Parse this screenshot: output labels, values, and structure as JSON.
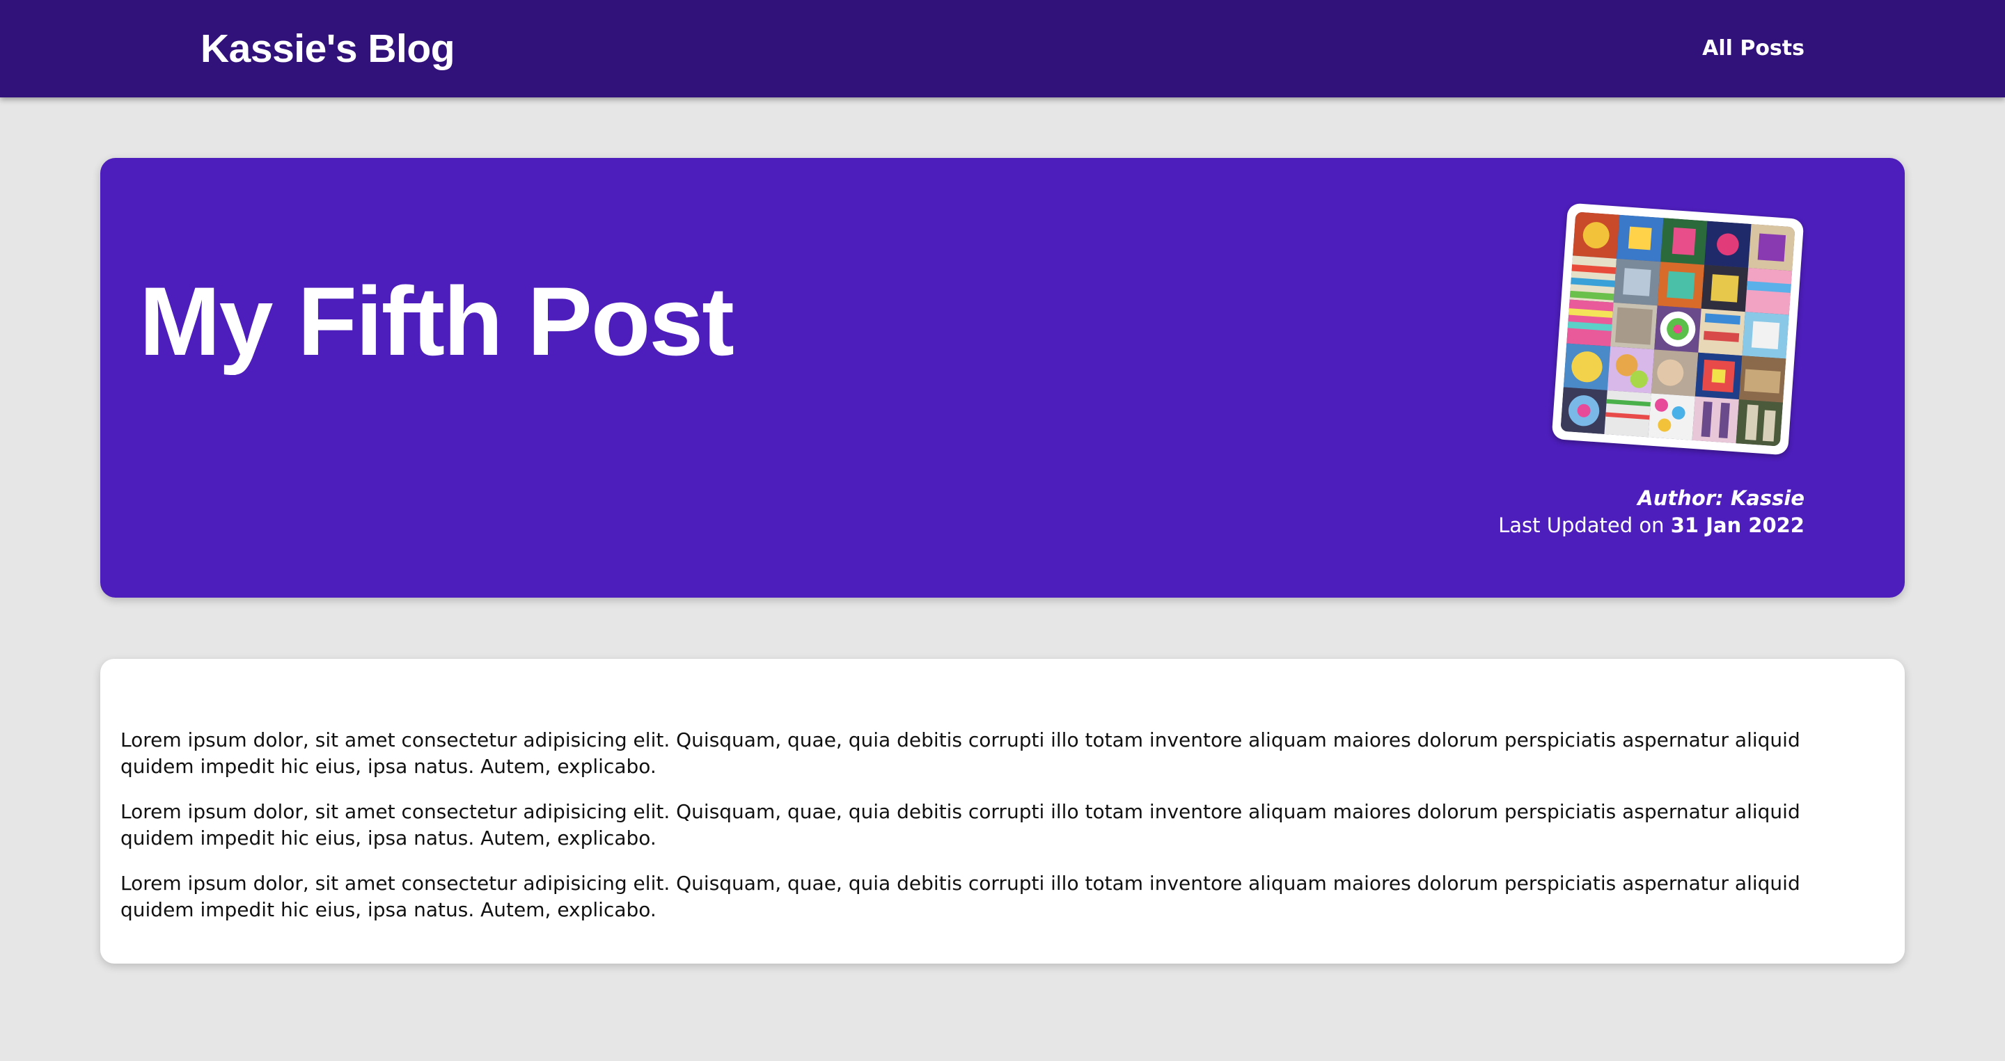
{
  "navbar": {
    "brand": "Kassie's Blog",
    "links": [
      {
        "label": "All Posts"
      }
    ]
  },
  "post": {
    "title": "My Fifth Post",
    "thumbnail_icon": "crochet-collage-image",
    "author_label": "Author: Kassie",
    "updated_prefix": "Last Updated on",
    "updated_date": "31 Jan 2022",
    "paragraphs": [
      "Lorem ipsum dolor, sit amet consectetur adipisicing elit. Quisquam, quae, quia debitis corrupti illo totam inventore aliquam maiores dolorum perspiciatis aspernatur aliquid quidem impedit hic eius, ipsa natus. Autem, explicabo.",
      "Lorem ipsum dolor, sit amet consectetur adipisicing elit. Quisquam, quae, quia debitis corrupti illo totam inventore aliquam maiores dolorum perspiciatis aspernatur aliquid quidem impedit hic eius, ipsa natus. Autem, explicabo.",
      "Lorem ipsum dolor, sit amet consectetur adipisicing elit. Quisquam, quae, quia debitis corrupti illo totam inventore aliquam maiores dolorum perspiciatis aspernatur aliquid quidem impedit hic eius, ipsa natus. Autem, explicabo."
    ]
  },
  "colors": {
    "navbar": "#31127a",
    "hero": "#4d1ebb",
    "page_background": "#e6e6e6",
    "card": "#ffffff"
  }
}
